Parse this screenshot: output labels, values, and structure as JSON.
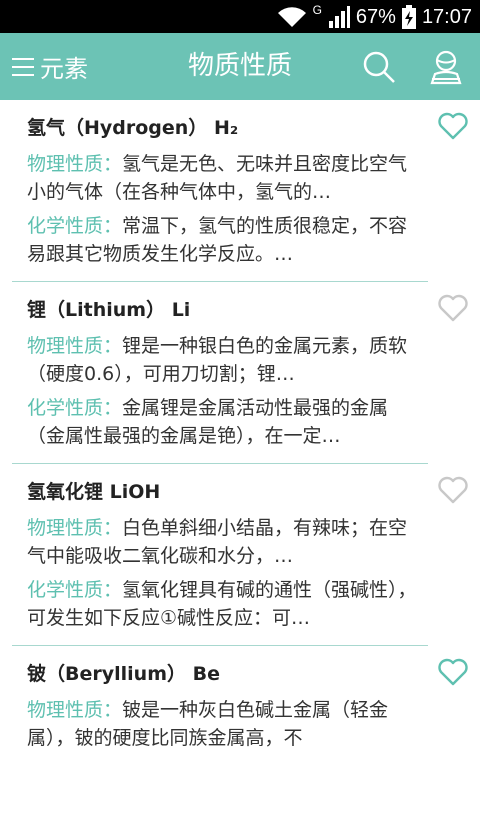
{
  "status_bar": {
    "network": "G",
    "battery": "67%",
    "time": "17:07",
    "icons": [
      "wifi-icon",
      "signal-icon",
      "battery-charging-icon"
    ]
  },
  "app_bar": {
    "menu_label": "元素",
    "title": "物质性质",
    "icons": [
      "menu-icon",
      "search-icon",
      "user-icon"
    ],
    "color": "#6cc3b5"
  },
  "accent_color": "#5ec0b0",
  "physical_label": "物理性质：",
  "chemical_label": "化学性质：",
  "items": [
    {
      "name": "氢气（Hydrogen）",
      "formula": "H₂",
      "physical": "氢气是无色、无味并且密度比空气小的气体（在各种气体中，氢气的…",
      "chemical": "常温下，氢气的性质很稳定，不容易跟其它物质发生化学反应。…",
      "favorited": true
    },
    {
      "name": "锂（Lithium）",
      "formula": "Li",
      "physical": "锂是一种银白色的金属元素，质软（硬度0.6），可用刀切割；锂…",
      "chemical": "金属锂是金属活动性最强的金属（金属性最强的金属是铯），在一定…",
      "favorited": false
    },
    {
      "name": "氢氧化锂",
      "formula": "LiOH",
      "physical": "白色单斜细小结晶，有辣味；在空气中能吸收二氧化碳和水分，…",
      "chemical": "氢氧化锂具有碱的通性（强碱性），可发生如下反应①碱性反应：可…",
      "favorited": false
    },
    {
      "name": "铍（Beryllium）",
      "formula": "Be",
      "physical": "铍是一种灰白色碱土金属（轻金属），铍的硬度比同族金属高，不",
      "favorited": true
    }
  ]
}
